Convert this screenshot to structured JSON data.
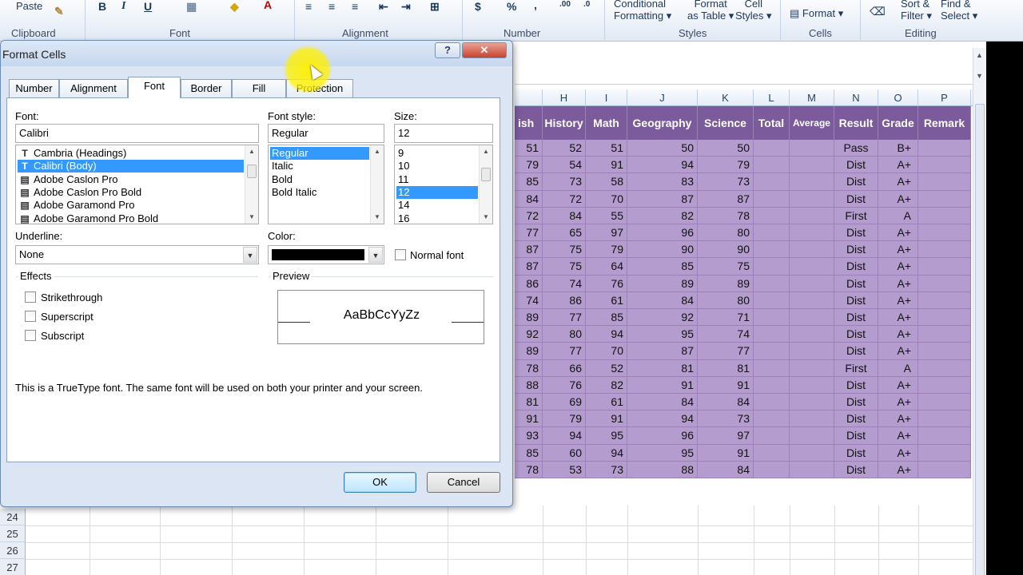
{
  "ribbon": {
    "paste_label": "Paste",
    "groups": [
      "Clipboard",
      "Font",
      "Alignment",
      "Number",
      "Styles",
      "Cells",
      "Editing"
    ],
    "number_symbols": [
      "$",
      "%",
      ","
    ],
    "styles": {
      "conditional": "Conditional",
      "conditional2": "Formatting",
      "format_table": "Format",
      "format_table2": "as Table",
      "cell": "Cell",
      "cell2": "Styles"
    },
    "cells": {
      "format": "Format"
    },
    "editing": {
      "sort": "Sort &",
      "filter": "Filter",
      "find": "Find &",
      "select": "Select"
    }
  },
  "sheet": {
    "columns": [
      "H",
      "I",
      "J",
      "K",
      "L",
      "M",
      "N",
      "O",
      "P"
    ],
    "headers": [
      "ish",
      "History",
      "Math",
      "Geography",
      "Science",
      "Total",
      "Average",
      "Result",
      "Grade",
      "Remark"
    ],
    "rows": [
      [
        "51",
        "52",
        "51",
        "50",
        "50",
        "",
        "",
        "Pass",
        "B+",
        ""
      ],
      [
        "79",
        "54",
        "91",
        "94",
        "79",
        "",
        "",
        "Dist",
        "A+",
        ""
      ],
      [
        "85",
        "73",
        "58",
        "83",
        "73",
        "",
        "",
        "Dist",
        "A+",
        ""
      ],
      [
        "84",
        "72",
        "70",
        "87",
        "87",
        "",
        "",
        "Dist",
        "A+",
        ""
      ],
      [
        "72",
        "84",
        "55",
        "82",
        "78",
        "",
        "",
        "First",
        "A",
        ""
      ],
      [
        "77",
        "65",
        "97",
        "96",
        "80",
        "",
        "",
        "Dist",
        "A+",
        ""
      ],
      [
        "87",
        "75",
        "79",
        "90",
        "90",
        "",
        "",
        "Dist",
        "A+",
        ""
      ],
      [
        "87",
        "75",
        "64",
        "85",
        "75",
        "",
        "",
        "Dist",
        "A+",
        ""
      ],
      [
        "86",
        "74",
        "76",
        "89",
        "89",
        "",
        "",
        "Dist",
        "A+",
        ""
      ],
      [
        "74",
        "86",
        "61",
        "84",
        "80",
        "",
        "",
        "Dist",
        "A+",
        ""
      ],
      [
        "89",
        "77",
        "85",
        "92",
        "71",
        "",
        "",
        "Dist",
        "A+",
        ""
      ],
      [
        "92",
        "80",
        "94",
        "95",
        "74",
        "",
        "",
        "Dist",
        "A+",
        ""
      ],
      [
        "89",
        "77",
        "70",
        "87",
        "77",
        "",
        "",
        "Dist",
        "A+",
        ""
      ],
      [
        "78",
        "66",
        "52",
        "81",
        "81",
        "",
        "",
        "First",
        "A",
        ""
      ],
      [
        "88",
        "76",
        "82",
        "91",
        "91",
        "",
        "",
        "Dist",
        "A+",
        ""
      ],
      [
        "81",
        "69",
        "61",
        "84",
        "84",
        "",
        "",
        "Dist",
        "A+",
        ""
      ],
      [
        "91",
        "79",
        "91",
        "94",
        "73",
        "",
        "",
        "Dist",
        "A+",
        ""
      ],
      [
        "93",
        "94",
        "95",
        "96",
        "97",
        "",
        "",
        "Dist",
        "A+",
        ""
      ],
      [
        "85",
        "60",
        "94",
        "95",
        "91",
        "",
        "",
        "Dist",
        "A+",
        ""
      ],
      [
        "78",
        "53",
        "73",
        "88",
        "84",
        "",
        "",
        "Dist",
        "A+",
        ""
      ]
    ],
    "row_numbers": [
      "24",
      "25",
      "26",
      "27"
    ]
  },
  "dialog": {
    "title": "Format Cells",
    "help": "?",
    "close": "✕",
    "tabs": [
      "Number",
      "Alignment",
      "Font",
      "Border",
      "Fill",
      "Protection"
    ],
    "active_tab": "Font",
    "font_label": "Font:",
    "font_value": "Calibri",
    "font_list": [
      "Cambria (Headings)",
      "Calibri (Body)",
      "Adobe Caslon Pro",
      "Adobe Caslon Pro Bold",
      "Adobe Garamond Pro",
      "Adobe Garamond Pro Bold"
    ],
    "font_selected_index": 1,
    "style_label": "Font style:",
    "style_value": "Regular",
    "style_list": [
      "Regular",
      "Italic",
      "Bold",
      "Bold Italic"
    ],
    "style_selected_index": 0,
    "size_label": "Size:",
    "size_value": "12",
    "size_list": [
      "9",
      "10",
      "11",
      "12",
      "14",
      "16"
    ],
    "size_selected_index": 3,
    "underline_label": "Underline:",
    "underline_value": "None",
    "color_label": "Color:",
    "color_value": "#000000",
    "normal_font": "Normal font",
    "effects_label": "Effects",
    "strikethrough": "Strikethrough",
    "superscript": "Superscript",
    "subscript": "Subscript",
    "preview_label": "Preview",
    "preview_text": "AaBbCcYyZz",
    "info_text": "This is a TrueType font.  The same font will be used on both your printer and your screen.",
    "ok": "OK",
    "cancel": "Cancel"
  }
}
